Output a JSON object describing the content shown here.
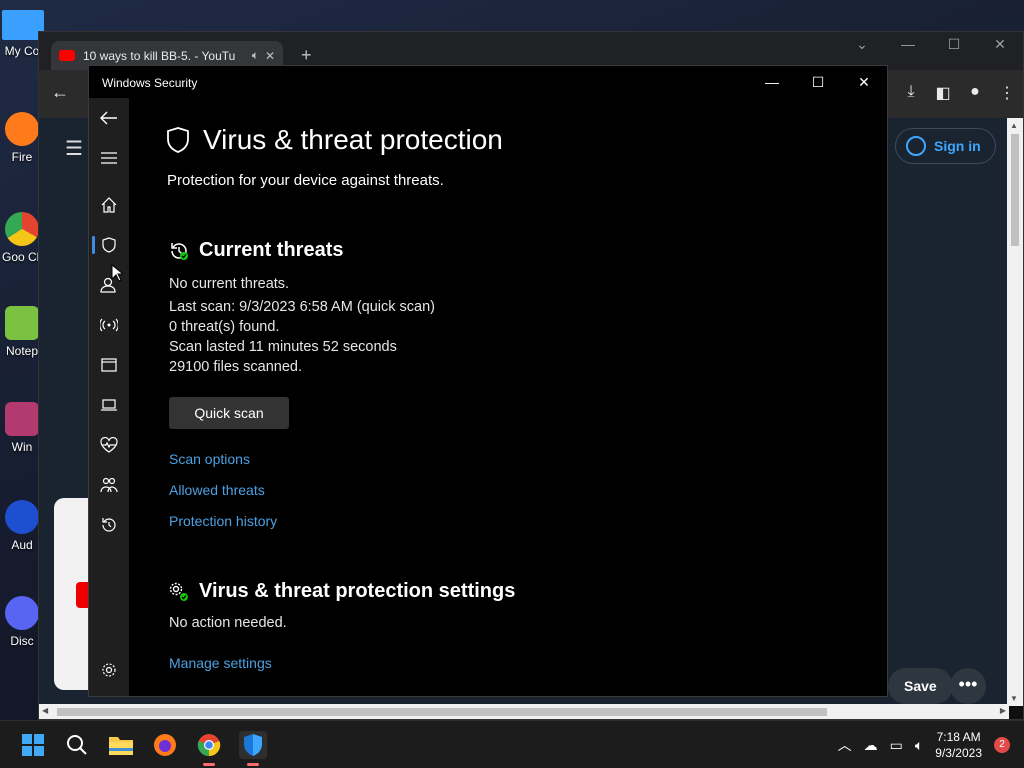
{
  "desktop": {
    "icons": [
      {
        "label": "My Co",
        "icon": "monitor-icon",
        "color": "#3aa0ff"
      },
      {
        "label": "Fire",
        "icon": "firefox-icon",
        "color": "#ff7a1a"
      },
      {
        "label": "Goo Chr",
        "icon": "chrome-icon",
        "color": "#e4442f"
      },
      {
        "label": "Notep",
        "icon": "notepad-icon",
        "color": "#7cc242"
      },
      {
        "label": "Win",
        "icon": "winrar-icon",
        "color": "#b23a6e"
      },
      {
        "label": "Aud",
        "icon": "audacity-icon",
        "color": "#1e4fd0"
      },
      {
        "label": "Disc",
        "icon": "discord-icon",
        "color": "#5865f2"
      }
    ]
  },
  "browser": {
    "tab_title": "10 ways to kill BB-5. - YouTu",
    "sign_in_label": "Sign in",
    "save_label": "Save",
    "more_label": "•••"
  },
  "security": {
    "window_title": "Windows Security",
    "page_title": "Virus & threat protection",
    "page_subtitle": "Protection for your device against threats.",
    "current_threats": {
      "heading": "Current threats",
      "status": "No current threats.",
      "last_scan": "Last scan: 9/3/2023 6:58 AM (quick scan)",
      "threats_found": "0 threat(s) found.",
      "duration": "Scan lasted 11 minutes 52 seconds",
      "files_scanned": "29100 files scanned.",
      "quick_scan_label": "Quick scan",
      "links": [
        "Scan options",
        "Allowed threats",
        "Protection history"
      ]
    },
    "settings": {
      "heading": "Virus & threat protection settings",
      "status": "No action needed.",
      "manage_link": "Manage settings"
    },
    "nav": [
      {
        "name": "back",
        "glyph": "←"
      },
      {
        "name": "menu",
        "glyph": "≡"
      },
      {
        "name": "home",
        "glyph": "⌂"
      },
      {
        "name": "virus-protection",
        "glyph": "⛉"
      },
      {
        "name": "account-protection",
        "glyph": "⚇"
      },
      {
        "name": "firewall",
        "glyph": "((•))"
      },
      {
        "name": "app-browser-control",
        "glyph": "▭"
      },
      {
        "name": "device-security",
        "glyph": "▭"
      },
      {
        "name": "device-performance",
        "glyph": "♡"
      },
      {
        "name": "family-options",
        "glyph": "⚇"
      },
      {
        "name": "protection-history",
        "glyph": "↺"
      },
      {
        "name": "settings",
        "glyph": "⚙"
      }
    ]
  },
  "taskbar": {
    "time": "7:18 AM",
    "date": "9/3/2023",
    "notification_count": "2"
  }
}
